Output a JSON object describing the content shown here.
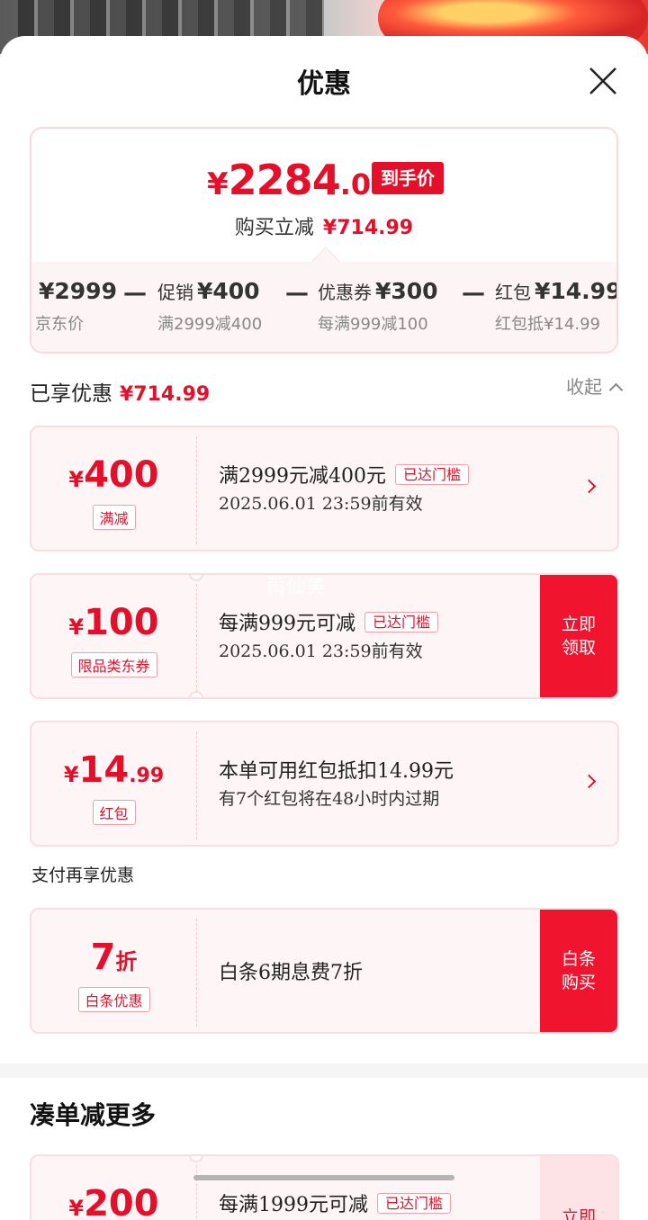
{
  "sheet": {
    "title": "优惠"
  },
  "price_summary": {
    "currency": "¥",
    "final_int": "2284",
    "final_dec": ".01",
    "final_tag": "到手价",
    "instant_label": "购买立减",
    "instant_amount": "¥714.99",
    "breakdown": [
      {
        "label": "",
        "value": "¥2999",
        "sub": "京东价"
      },
      {
        "label": "促销",
        "value": "¥400",
        "sub": "满2999减400"
      },
      {
        "label": "优惠券",
        "value": "¥300",
        "sub": "每满999减100"
      },
      {
        "label": "红包",
        "value": "¥14.99",
        "sub": "红包抵¥14.99"
      }
    ],
    "minus": "—"
  },
  "enjoyed": {
    "label": "已享优惠",
    "amount": "¥714.99",
    "collapse_label": "收起"
  },
  "coupons": [
    {
      "yen": "¥",
      "int": "400",
      "dec": "",
      "tag": "满减",
      "title": "满2999元减400元",
      "badge": "已达门槛",
      "desc": "2025.06.01 23:59前有效"
    },
    {
      "yen": "¥",
      "int": "100",
      "dec": "",
      "tag": "限品类东券",
      "title": "每满999元可减",
      "badge": "已达门槛",
      "desc": "2025.06.01 23:59前有效",
      "action": "立即领取"
    },
    {
      "yen": "¥",
      "int": "14",
      "dec": ".99",
      "tag": "红包",
      "title": "本单可用红包抵扣14.99元",
      "desc": "有7个红包将在48小时内过期"
    }
  ],
  "pay": {
    "heading": "支付再享优惠",
    "item": {
      "int": "7",
      "unit": "折",
      "tag": "白条优惠",
      "title": "白条6期息费7折",
      "action": "白条购买"
    }
  },
  "more": {
    "heading": "凑单减更多",
    "item": {
      "yen": "¥",
      "int": "200",
      "title": "每满1999元可减",
      "badge": "已达门槛",
      "action": "立即"
    }
  },
  "watermark": "莆仙美",
  "colors": {
    "accent": "#e4102a",
    "action": "#f0142f",
    "card_bg": "#fdf5f6",
    "border": "#fadde1"
  }
}
